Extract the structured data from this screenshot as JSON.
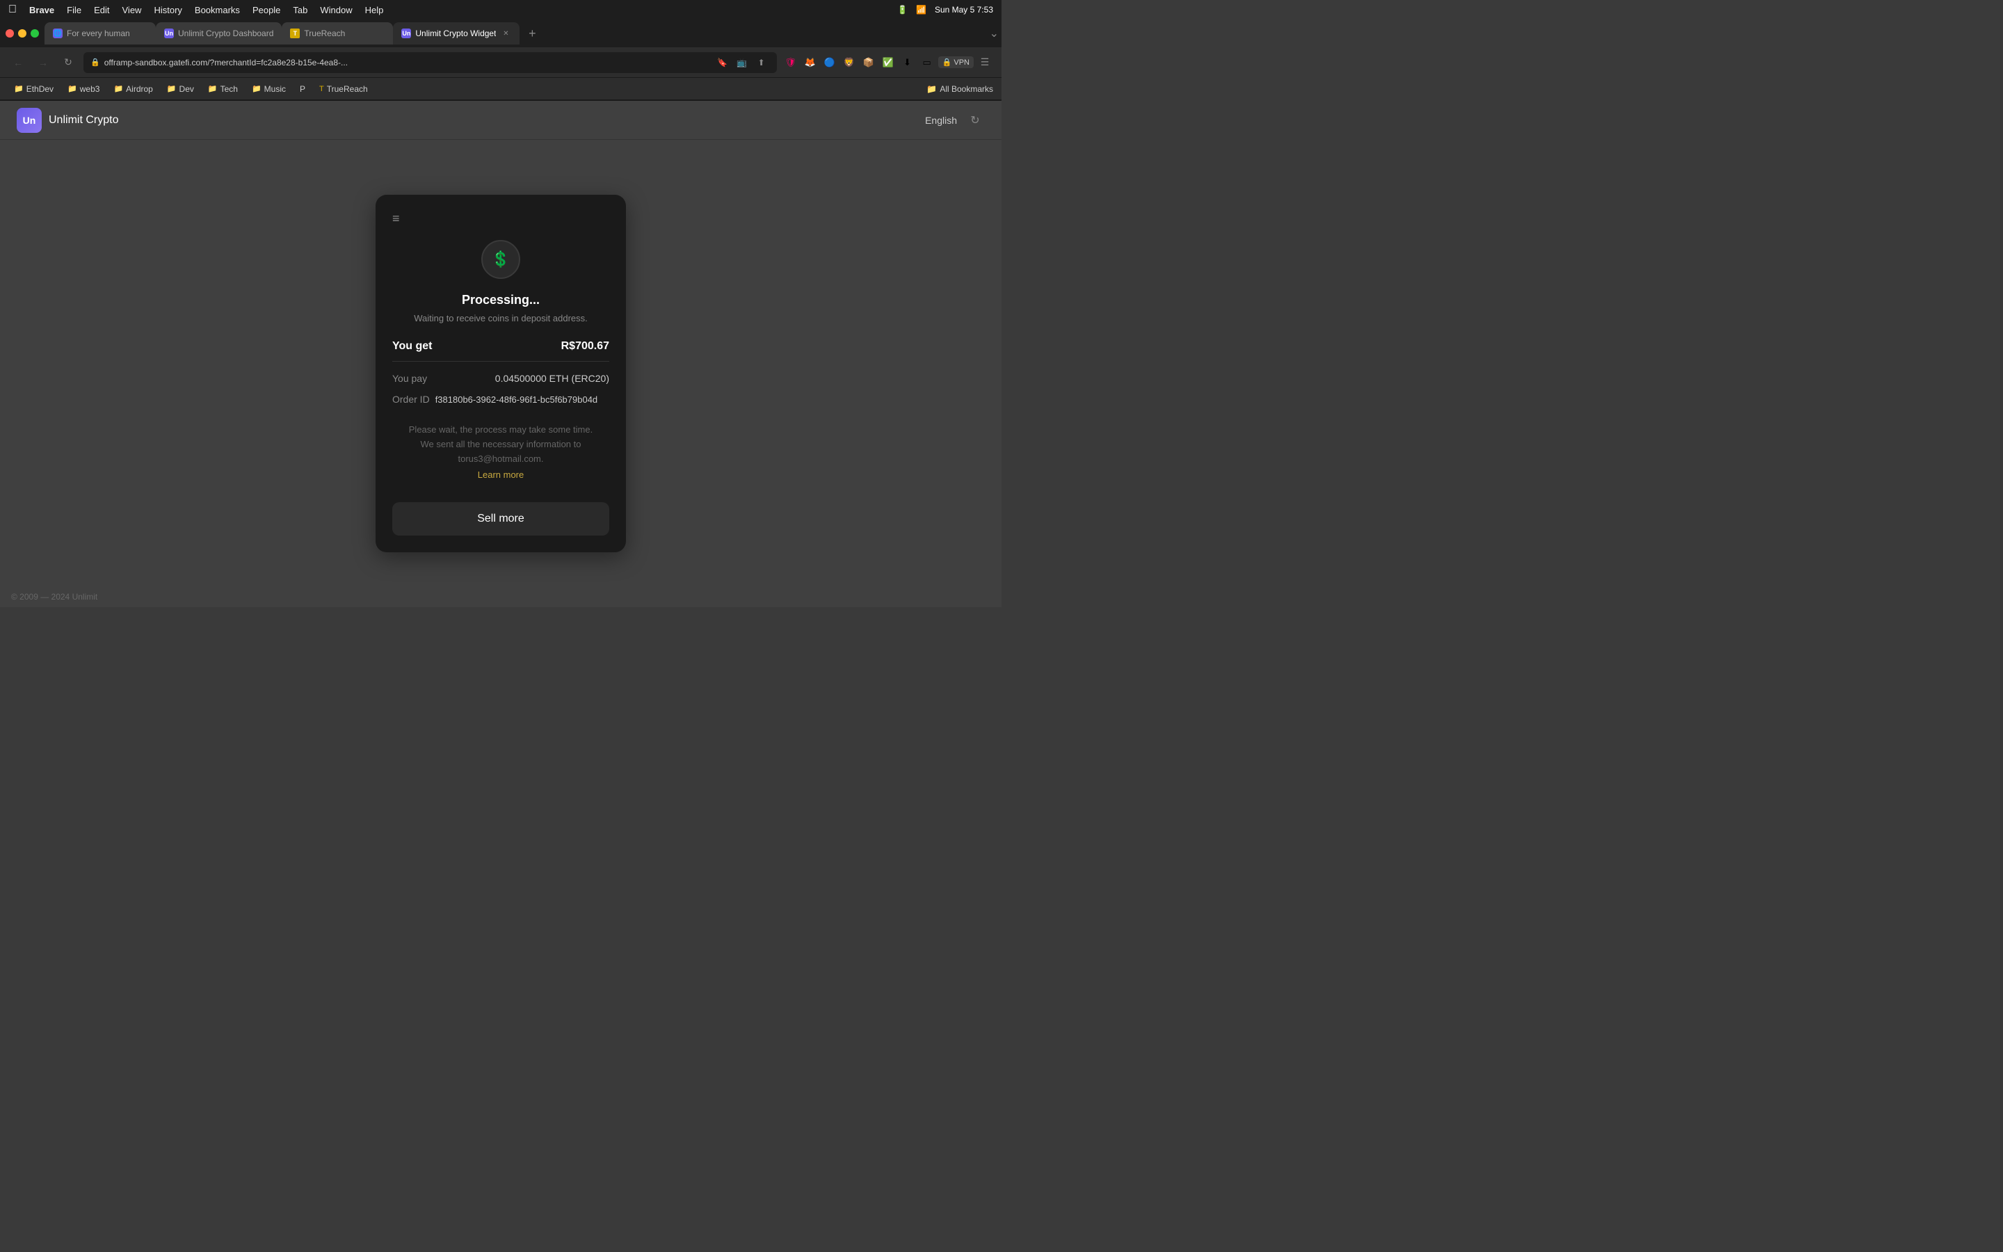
{
  "menubar": {
    "apple": "⌘",
    "items": [
      "Brave",
      "File",
      "Edit",
      "View",
      "History",
      "Bookmarks",
      "People",
      "Tab",
      "Window",
      "Help"
    ],
    "right": {
      "time": "Sun May 5  7:53"
    }
  },
  "tabs": {
    "items": [
      {
        "id": "for-every-human",
        "label": "For every human",
        "favicon": "🌐",
        "active": false
      },
      {
        "id": "unlimit-dashboard",
        "label": "Unlimit Crypto Dashboard",
        "favicon": "Un",
        "active": false
      },
      {
        "id": "truereach",
        "label": "TrueReach",
        "favicon": "T",
        "active": false
      },
      {
        "id": "unlimit-widget",
        "label": "Unlimit Crypto Widget",
        "favicon": "Un",
        "active": true,
        "closable": true
      }
    ],
    "new_tab_title": "+"
  },
  "address_bar": {
    "url": "offramp-sandbox.gatefi.com/?merchantId=fc2a8e28-b15e-4ea8-...",
    "domain": "offramp-sandbox.gatefi.com"
  },
  "bookmarks": {
    "items": [
      {
        "id": "ethddev",
        "label": "EthDev",
        "type": "folder"
      },
      {
        "id": "web3",
        "label": "web3",
        "type": "folder"
      },
      {
        "id": "airdrop",
        "label": "Airdrop",
        "type": "folder"
      },
      {
        "id": "dev",
        "label": "Dev",
        "type": "folder"
      },
      {
        "id": "tech",
        "label": "Tech",
        "type": "folder"
      },
      {
        "id": "music",
        "label": "Music",
        "type": "folder"
      },
      {
        "id": "p",
        "label": "P",
        "type": "item"
      },
      {
        "id": "truereach-bm",
        "label": "TrueReach",
        "type": "item"
      }
    ],
    "right": "All Bookmarks"
  },
  "app": {
    "logo_text": "Un",
    "name": "Unlimit Crypto",
    "language": "English",
    "refresh_icon": "↻"
  },
  "widget": {
    "menu_icon": "≡",
    "processing_icon": "$",
    "title": "Processing...",
    "subtitle": "Waiting to receive coins in deposit address.",
    "you_get_label": "You get",
    "you_get_value": "R$700.67",
    "you_pay_label": "You pay",
    "you_pay_value": "0.04500000 ETH (ERC20)",
    "order_id_label": "Order ID",
    "order_id_value": "f38180b6-3962-48f6-96f1-bc5f6b79b04d",
    "notice_line1": "Please wait, the process may take some time.",
    "notice_line2": "We sent all the necessary information to",
    "notice_line3": "torus3@hotmail.com.",
    "learn_more": "Learn more",
    "sell_more_btn": "Sell more"
  },
  "footer": {
    "copyright": "© 2009 — 2024 Unlimit"
  }
}
